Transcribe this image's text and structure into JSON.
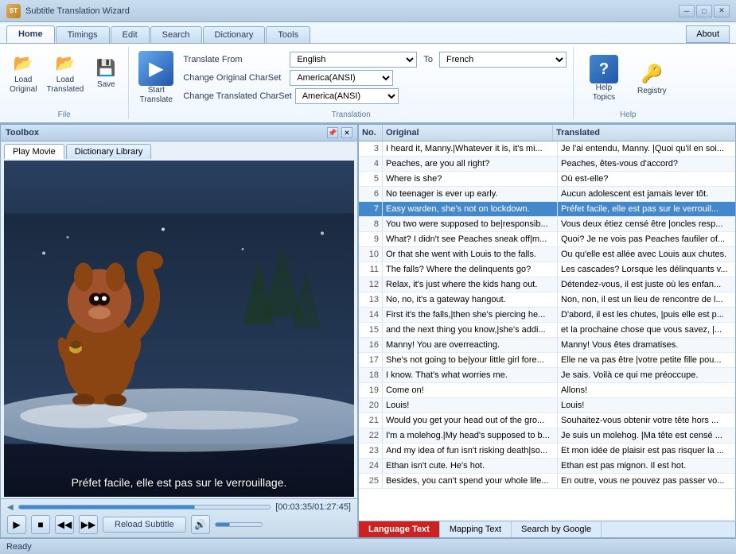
{
  "titlebar": {
    "title": "Subtitle Translation Wizard",
    "app_icon": "ST",
    "min": "─",
    "max": "□",
    "close": "✕"
  },
  "ribbon": {
    "tabs": [
      "Home",
      "Timings",
      "Edit",
      "Search",
      "Dictionary",
      "Tools"
    ],
    "active_tab": "Home",
    "about": "About",
    "file_group": {
      "label": "File",
      "buttons": [
        {
          "label": "Load\nOriginal",
          "icon": "📄"
        },
        {
          "label": "Load\nTranslated",
          "icon": "📄"
        },
        {
          "label": "Save",
          "icon": "💾"
        }
      ]
    },
    "translation_group": {
      "label": "Translation",
      "translate_from_label": "Translate From",
      "translate_from_value": "English",
      "to_label": "To",
      "to_value": "French",
      "charset_orig_label": "Change Original CharSet",
      "charset_orig_value": "America(ANSI)",
      "charset_trans_label": "Change Translated CharSet",
      "charset_trans_value": "America(ANSI)",
      "start_label": "Start\nTranslate"
    },
    "help_group": {
      "label": "Help",
      "help_topics": "Help\nTopics",
      "registry": "Registry"
    }
  },
  "toolbox": {
    "title": "Toolbox",
    "tabs": [
      "Play Movie",
      "Dictionary Library"
    ],
    "active_tab": "Play Movie"
  },
  "player": {
    "subtitle_text": "Préfet facile, elle est pas sur le verrouillage.",
    "time_current": "00:03:35",
    "time_total": "01:27:45",
    "time_display": "[00:03:35/01:27:45]",
    "reload_btn": "Reload Subtitle"
  },
  "table": {
    "headers": [
      "No.",
      "Original",
      "Translated"
    ],
    "rows": [
      {
        "no": 3,
        "orig": "I heard it, Manny.|Whatever it is, it's mi...",
        "trans": "Je l'ai entendu, Manny. |Quoi qu'il en soi..."
      },
      {
        "no": 4,
        "orig": "Peaches, are you all right?",
        "trans": "Peaches, êtes-vous d'accord?"
      },
      {
        "no": 5,
        "orig": "Where is she?",
        "trans": "Où est-elle?"
      },
      {
        "no": 6,
        "orig": "No teenager is ever up early.",
        "trans": "Aucun adolescent est jamais lever tôt."
      },
      {
        "no": 7,
        "orig": "Easy warden, she's not on lockdown.",
        "trans": "Préfet facile, elle est pas sur le verrouil...",
        "selected": true
      },
      {
        "no": 8,
        "orig": "You two were supposed to be|responsib...",
        "trans": "Vous deux étiez censé être |oncles resp..."
      },
      {
        "no": 9,
        "orig": "What? I didn't see Peaches sneak off|m...",
        "trans": "Quoi? Je ne vois pas Peaches faufiler of..."
      },
      {
        "no": 10,
        "orig": "Or that she went with Louis to the falls.",
        "trans": "Ou qu'elle est allée avec Louis aux chutes."
      },
      {
        "no": 11,
        "orig": "The falls? Where the delinquents go?",
        "trans": "Les cascades? Lorsque les délinquants v..."
      },
      {
        "no": 12,
        "orig": "Relax, it's just where the kids hang out.",
        "trans": "Détendez-vous, il est juste où les enfan..."
      },
      {
        "no": 13,
        "orig": "No, no, it's a gateway hangout.",
        "trans": "Non, non, il est un lieu de rencontre de l..."
      },
      {
        "no": 14,
        "orig": "First it's the falls,|then she's piercing he...",
        "trans": "D'abord, il est les chutes, |puis elle est p..."
      },
      {
        "no": 15,
        "orig": "and the next thing you know,|she's addi...",
        "trans": "et la prochaine chose que vous savez, |..."
      },
      {
        "no": 16,
        "orig": "Manny! You are overreacting.",
        "trans": "Manny! Vous êtes dramatises."
      },
      {
        "no": 17,
        "orig": "She's not going to be|your little girl fore...",
        "trans": "Elle ne va pas être |votre petite fille pou..."
      },
      {
        "no": 18,
        "orig": "I know. That's what worries me.",
        "trans": "Je sais. Voilà ce qui me préoccupe."
      },
      {
        "no": 19,
        "orig": "Come on!",
        "trans": "Allons!"
      },
      {
        "no": 20,
        "orig": "Louis!",
        "trans": "Louis!"
      },
      {
        "no": 21,
        "orig": "Would you get your head out of the gro...",
        "trans": "Souhaitez-vous obtenir votre tête hors ..."
      },
      {
        "no": 22,
        "orig": "I'm a molehog.|My head's supposed to b...",
        "trans": "Je suis un molehog. |Ma tête est censé ..."
      },
      {
        "no": 23,
        "orig": "And my idea of fun isn't risking death|so...",
        "trans": "Et mon idée de plaisir est pas risquer la ..."
      },
      {
        "no": 24,
        "orig": "Ethan isn't cute. He's hot.",
        "trans": "Ethan est pas mignon. Il est hot."
      },
      {
        "no": 25,
        "orig": "Besides, you can't spend your whole life...",
        "trans": "En outre, vous ne pouvez pas passer vo..."
      }
    ]
  },
  "bottom_tabs": [
    "Language Text",
    "Mapping Text",
    "Search by Google"
  ],
  "active_bottom_tab": "Language Text",
  "status": {
    "text": "Ready"
  }
}
